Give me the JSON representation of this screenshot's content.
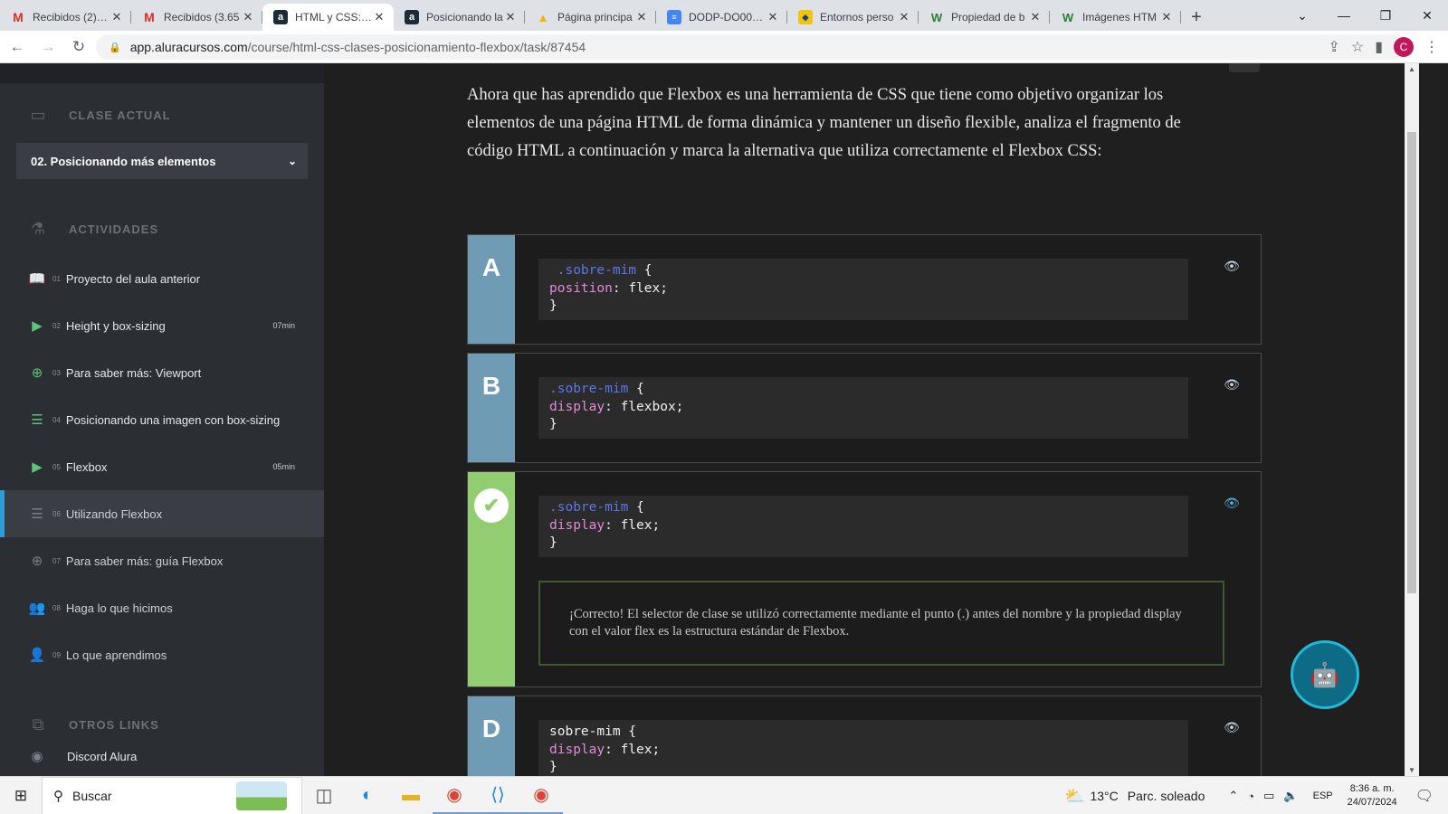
{
  "browser": {
    "tabs": [
      {
        "title": "Recibidos (2) - c",
        "favicon": "gmail-icon",
        "active": false
      },
      {
        "title": "Recibidos (3.65",
        "favicon": "gmail-icon",
        "active": false
      },
      {
        "title": "HTML y CSS: Cl",
        "favicon": "alura-icon",
        "active": true
      },
      {
        "title": "Posicionando la",
        "favicon": "alura-icon",
        "active": false
      },
      {
        "title": "Página principa",
        "favicon": "drive-icon",
        "active": false
      },
      {
        "title": "DODP-DO006-F",
        "favicon": "docs-icon",
        "active": false
      },
      {
        "title": "Entornos perso",
        "favicon": "entornos-icon",
        "active": false
      },
      {
        "title": "Propiedad de b",
        "favicon": "w3schools-icon",
        "active": false
      },
      {
        "title": "Imágenes HTM",
        "favicon": "w3schools-icon",
        "active": false
      }
    ],
    "url_host": "app.aluracursos.com",
    "url_path": "/course/html-css-clases-posicionamiento-flexbox/task/87454",
    "avatar_letter": "C"
  },
  "sidebar": {
    "current_class_heading": "CLASE ACTUAL",
    "current_lesson": "02. Posicionando más elementos",
    "activities_heading": "ACTIVIDADES",
    "activities": [
      {
        "num": "01",
        "label": "Proyecto del aula anterior",
        "duration": "",
        "icon": "book-icon"
      },
      {
        "num": "02",
        "label": "Height y box-sizing",
        "duration": "07min",
        "icon": "video-play-icon"
      },
      {
        "num": "03",
        "label": "Para saber más: Viewport",
        "duration": "",
        "icon": "plus-circle-icon"
      },
      {
        "num": "04",
        "label": "Posicionando una imagen con box-sizing",
        "duration": "",
        "icon": "list-icon"
      },
      {
        "num": "05",
        "label": "Flexbox",
        "duration": "05min",
        "icon": "video-play-icon"
      },
      {
        "num": "06",
        "label": "Utilizando Flexbox",
        "duration": "",
        "icon": "list-icon"
      },
      {
        "num": "07",
        "label": "Para saber más: guía Flexbox",
        "duration": "",
        "icon": "plus-circle-icon"
      },
      {
        "num": "08",
        "label": "Haga lo que hicimos",
        "duration": "",
        "icon": "people-icon"
      },
      {
        "num": "09",
        "label": "Lo que aprendimos",
        "duration": "",
        "icon": "user-check-icon"
      }
    ],
    "other_links_heading": "OTROS LINKS",
    "discord_link": "Discord Alura"
  },
  "main": {
    "question": "Ahora que has aprendido que Flexbox es una herramienta de CSS que tiene como objetivo organizar los elementos de una página HTML de forma dinámica y mantener un diseño flexible, analiza el fragmento de código HTML a continuación y marca la alternativa que utiliza correctamente el Flexbox CSS:",
    "alternatives": [
      {
        "letter": "A",
        "selector": " .sobre-mim",
        "property": "position",
        "value": "flex;",
        "correct": false
      },
      {
        "letter": "B",
        "selector": ".sobre-mim",
        "property": "display",
        "value": "flexbox;",
        "correct": false
      },
      {
        "letter": "C",
        "selector": ".sobre-mim",
        "property": "display",
        "value": "flex;",
        "correct": true,
        "feedback": "¡Correcto! El selector de clase se utilizó correctamente mediante el punto (.) antes del nombre y la propiedad display con el valor flex es la estructura estándar de Flexbox."
      },
      {
        "letter": "D",
        "selector": "sobre-mim",
        "property": "display",
        "value": "flex;",
        "correct": false
      }
    ]
  },
  "taskbar": {
    "search_placeholder": "Buscar",
    "weather_temp": "13°C",
    "weather_desc": "Parc. soleado",
    "lang": "ESP",
    "time": "8:36 a. m.",
    "date": "24/07/2024"
  },
  "colors": {
    "letter_bg": "#6f9bb5",
    "correct_bg": "#93cd71",
    "code_selector": "#5d77e8",
    "code_property": "#e08bd8",
    "current_activity_accent": "#2f9bd9"
  }
}
